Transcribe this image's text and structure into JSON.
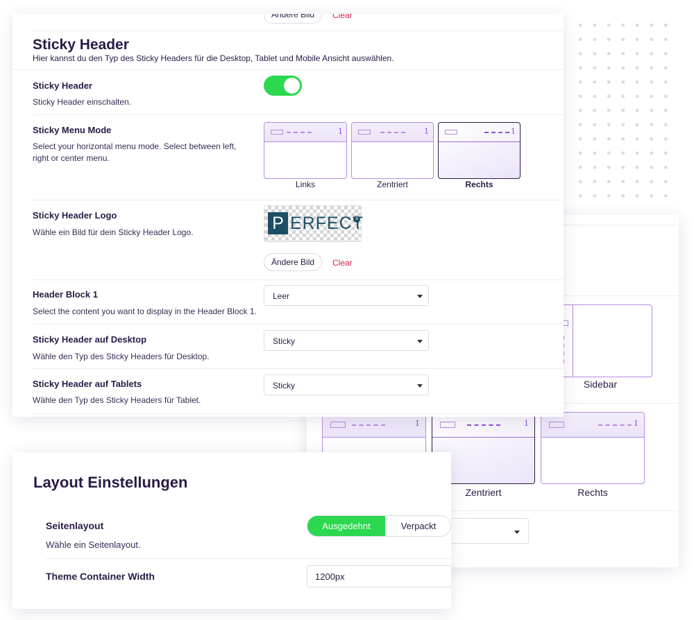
{
  "sticky_header": {
    "top_cut": {
      "change_image": "Ändere Bild",
      "clear": "Clear"
    },
    "title": "Sticky Header",
    "description": "Hier kannst du den Typ des Sticky Headers für die Desktop, Tablet und Mobile Ansicht auswählen.",
    "toggle": {
      "label": "Sticky Header",
      "description": "Sticky Header einschalten.",
      "enabled": true
    },
    "menu_mode": {
      "label": "Sticky Menu Mode",
      "description": "Select your horizontal menu mode. Select between left, right or center menu.",
      "options": [
        {
          "caption": "Links",
          "num": "1"
        },
        {
          "caption": "Zentriert",
          "num": "1"
        },
        {
          "caption": "Rechts",
          "num": "1"
        }
      ],
      "selected": "Rechts"
    },
    "logo": {
      "label": "Sticky Header Logo",
      "description": "Wähle ein Bild für dein Sticky Header Logo.",
      "logo_p": "P",
      "logo_text": "ERFECT",
      "logo_sup": "3",
      "change_image": "Ändere Bild",
      "clear": "Clear"
    },
    "header_block": {
      "label": "Header Block 1",
      "description": "Select the content you want to display in the Header Block 1.",
      "value": "Leer"
    },
    "desktop": {
      "label": "Sticky Header auf Desktop",
      "description": "Wähle den Typ des Sticky Headers für Desktop.",
      "value": "Sticky"
    },
    "tablet": {
      "label": "Sticky Header auf Tablets",
      "description": "Wähle den Typ des Sticky Headers für Tablet.",
      "value": "Sticky"
    }
  },
  "back_panel": {
    "sidebar_caption": "Sidebar",
    "menu_options": [
      {
        "caption": "",
        "num": "1"
      },
      {
        "caption": "Zentriert",
        "num": "1"
      },
      {
        "caption": "Rechts",
        "num": "1"
      }
    ]
  },
  "layout": {
    "title": "Layout Einstellungen",
    "page_layout": {
      "label": "Seitenlayout",
      "description": "Wähle ein Seitenlayout.",
      "options": [
        "Ausgedehnt",
        "Verpackt"
      ],
      "selected": "Ausgedehnt"
    },
    "container_width": {
      "label": "Theme Container Width",
      "value": "1200px"
    }
  },
  "colors": {
    "accent_green": "#2bd84f",
    "accent_purple": "#b889e3",
    "text_dark": "#2a1a45",
    "clear_red": "#d0214b"
  }
}
